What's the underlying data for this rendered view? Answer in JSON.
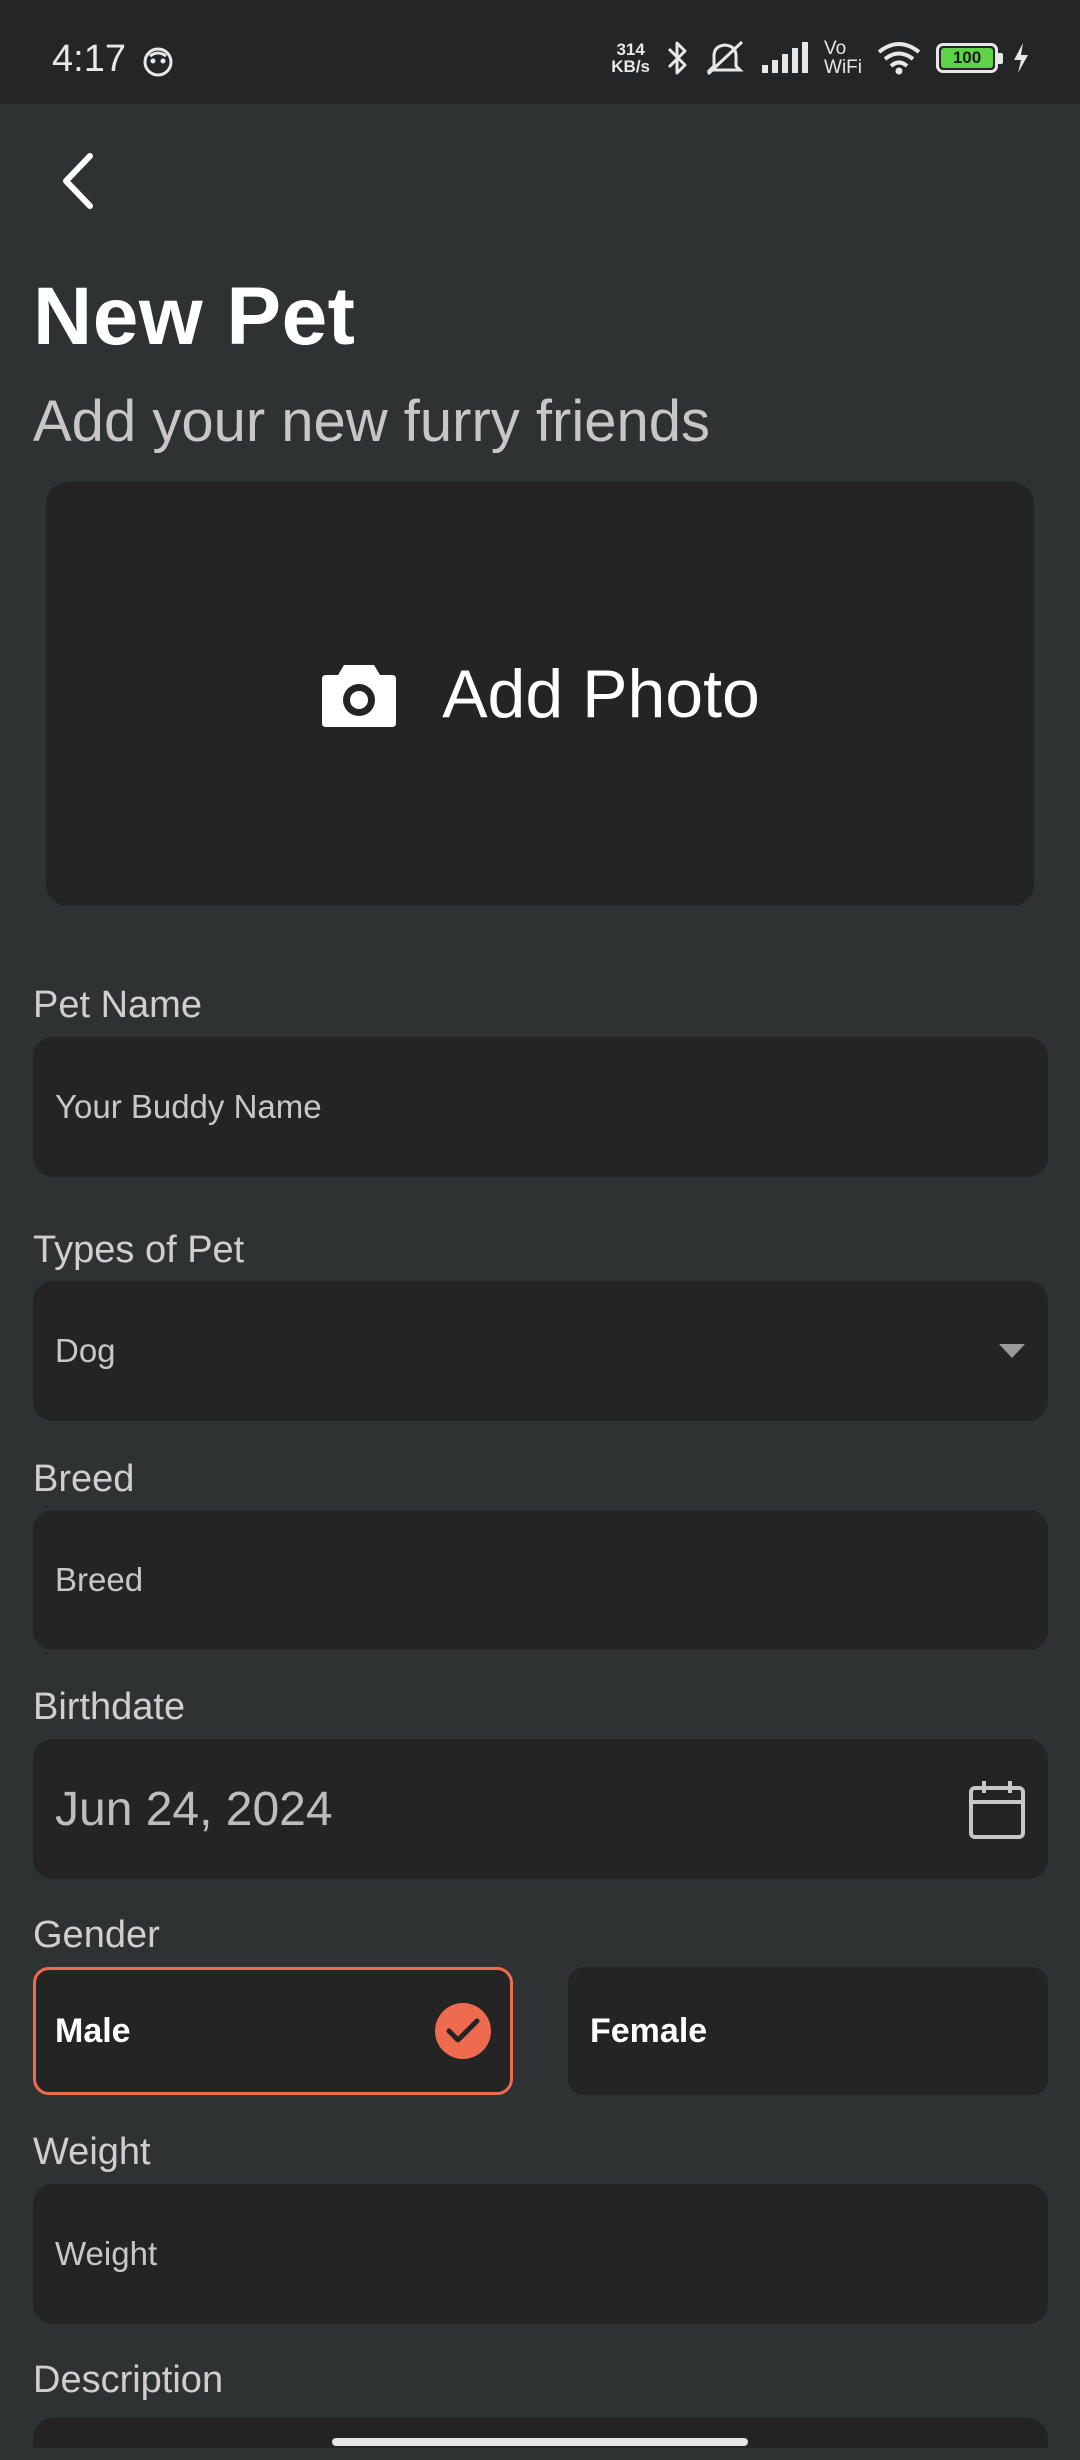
{
  "status_bar": {
    "time": "4:17",
    "net_speed_value": "314",
    "net_speed_unit": "KB/s",
    "volte_top": "Vo",
    "volte_bottom": "WiFi",
    "battery": "100"
  },
  "header": {
    "title": "New Pet",
    "subtitle": "Add your new furry friends"
  },
  "photo": {
    "label": "Add Photo",
    "icon": "camera-icon"
  },
  "form": {
    "pet_name": {
      "label": "Pet Name",
      "placeholder": "Your Buddy Name"
    },
    "pet_type": {
      "label": "Types of Pet",
      "value": "Dog"
    },
    "breed": {
      "label": "Breed",
      "placeholder": "Breed"
    },
    "birthdate": {
      "label": "Birthdate",
      "value": "Jun 24, 2024"
    },
    "gender": {
      "label": "Gender",
      "options": [
        "Male",
        "Female"
      ],
      "selected": "Male"
    },
    "weight": {
      "label": "Weight",
      "placeholder": "Weight"
    },
    "description": {
      "label": "Description"
    }
  },
  "colors": {
    "background": "#2f3233",
    "field": "#242424",
    "accent": "#ef6b4f"
  }
}
